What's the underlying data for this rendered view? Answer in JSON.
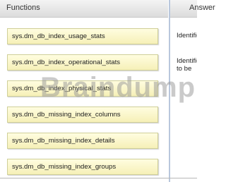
{
  "headers": {
    "functions": "Functions",
    "answer": "Answer"
  },
  "functions": [
    "sys.dm_db_index_usage_stats",
    "sys.dm_db_index_operational_stats",
    "sys.dm_db_index_physical_stats",
    "sys.dm_db_missing_index_columns",
    "sys.dm_db_missing_index_details",
    "sys.dm_db_missing_index_groups"
  ],
  "answer_descriptions": [
    {
      "line1": "Identifies"
    },
    {
      "line1": "Identifies",
      "line2": "to be"
    }
  ],
  "watermark": "Braindump",
  "colors": {
    "box_fill": "#fcf7c8",
    "box_border": "#cfcf98",
    "divider": "#b9c7dc"
  }
}
